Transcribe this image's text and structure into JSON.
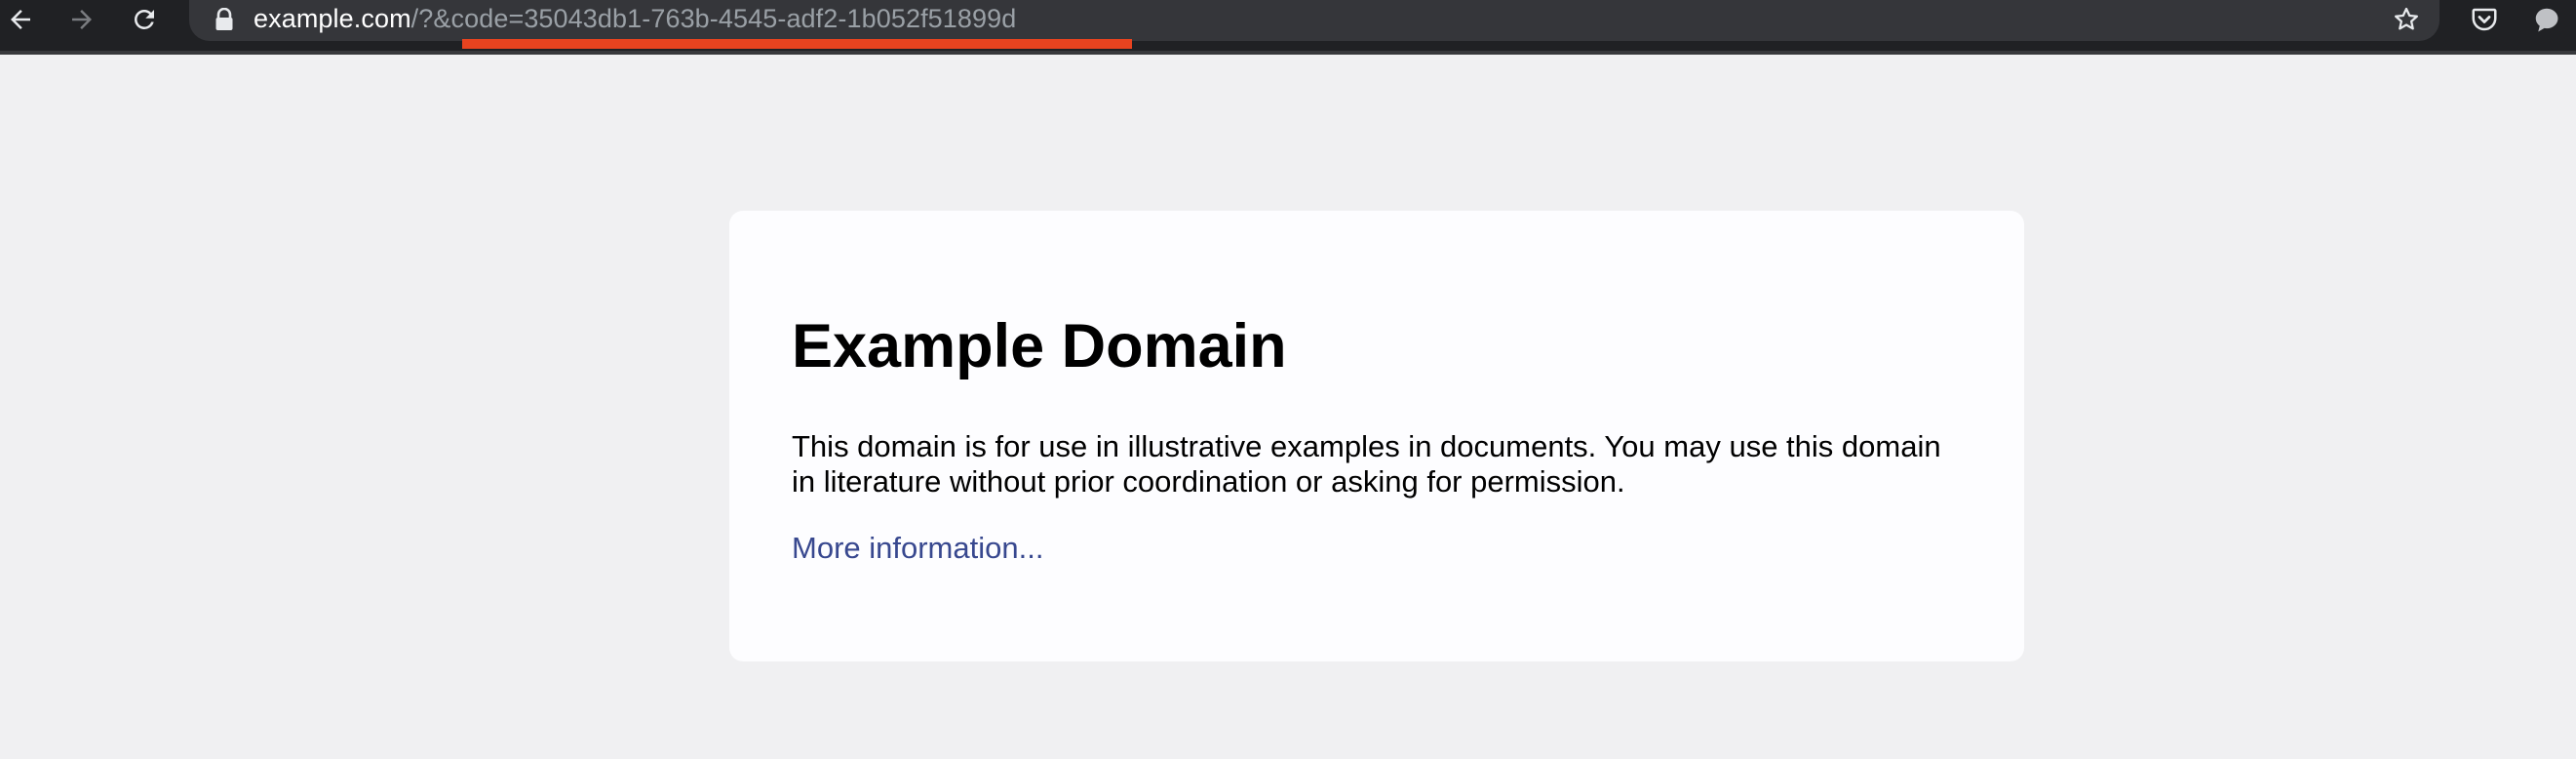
{
  "browser": {
    "url_host": "example.com",
    "url_query": "/?&code=35043db1-763b-4545-adf2-1b052f51899d",
    "icons": {
      "back": "arrow-left-icon",
      "forward": "arrow-right-icon",
      "reload": "reload-icon",
      "lock": "lock-icon",
      "bookmark": "star-icon",
      "pocket": "pocket-icon",
      "chat": "chat-bubble-icon"
    },
    "colors": {
      "toolbar": "#202124",
      "address_bar": "#35363a",
      "url_host": "#ffffff",
      "url_query": "#9aa0a6",
      "highlight_underline": "#e8431f"
    }
  },
  "page": {
    "title": "Example Domain",
    "description": "This domain is for use in illustrative examples in documents. You may use this domain in literature without prior coordination or asking for permission.",
    "link_label": "More information...",
    "colors": {
      "background": "#f0f0f2",
      "card": "#fdfdff",
      "link": "#38488f"
    }
  }
}
